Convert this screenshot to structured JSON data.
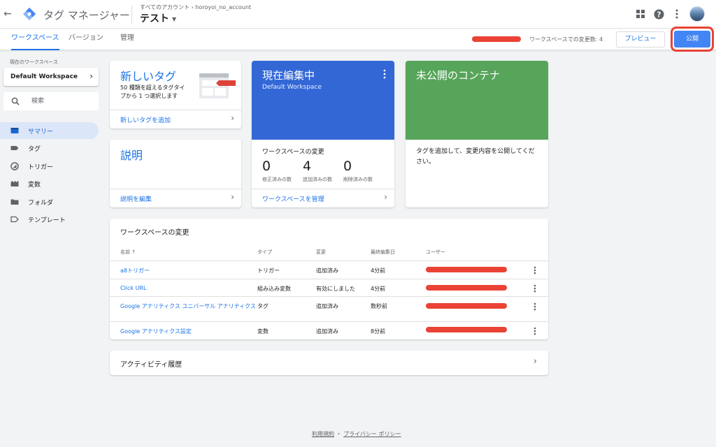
{
  "header": {
    "app_title": "タグ マネージャー",
    "account_breadcrumb": "すべてのアカウント › horoyoi_no_account",
    "container_name": "テスト",
    "icons": [
      "apps-grid-icon",
      "help-icon",
      "more-vert-icon",
      "account-avatar"
    ]
  },
  "tabs": [
    {
      "label": "ワークスペース",
      "active": true
    },
    {
      "label": "バージョン",
      "active": false
    },
    {
      "label": "管理",
      "active": false
    }
  ],
  "toolbar": {
    "workspace_changes": "ワークスペースでの変更数: 4",
    "preview_label": "プレビュー",
    "publish_label": "公開"
  },
  "sidebar": {
    "current_workspace_label": "現在のワークスペース",
    "workspace_name": "Default Workspace",
    "search_placeholder": "検索",
    "items": [
      {
        "label": "サマリー",
        "icon": "summary-icon",
        "active": true
      },
      {
        "label": "タグ",
        "icon": "tag-icon",
        "active": false
      },
      {
        "label": "トリガー",
        "icon": "trigger-icon",
        "active": false
      },
      {
        "label": "変数",
        "icon": "variable-icon",
        "active": false
      },
      {
        "label": "フォルダ",
        "icon": "folder-icon",
        "active": false
      },
      {
        "label": "テンプレート",
        "icon": "template-icon",
        "active": false
      }
    ]
  },
  "cards": {
    "new_tag": {
      "title": "新しいタグ",
      "description": "50 種類を超えるタグタイプから 1 つ選択します",
      "link": "新しいタグを追加"
    },
    "description": {
      "title": "説明",
      "link": "説明を編集"
    },
    "editing": {
      "title": "現在編集中",
      "workspace": "Default Workspace",
      "changes_label": "ワークスペースの変更",
      "stats": [
        {
          "value": "0",
          "label": "修正済みの数"
        },
        {
          "value": "4",
          "label": "追加済みの数"
        },
        {
          "value": "0",
          "label": "削除済みの数"
        }
      ],
      "link": "ワークスペースを管理"
    },
    "unpublished": {
      "title": "未公開のコンテナ",
      "body": "タグを追加して、変更内容を公開してください。"
    }
  },
  "changes_table": {
    "title": "ワークスペースの変更",
    "headers": [
      "名前 ↑",
      "タイプ",
      "変更",
      "最終編集日",
      "ユーザー"
    ],
    "rows": [
      {
        "name": "a8トリガー",
        "type": "トリガー",
        "change": "追加済み",
        "edited": "4分前"
      },
      {
        "name": "Click URL",
        "type": "組み込み変数",
        "change": "有効にしました",
        "edited": "4分前"
      },
      {
        "name": "Google アナリティクス ユニバーサル アナリティクス",
        "type": "タグ",
        "change": "追加済み",
        "edited": "数秒前"
      },
      {
        "name": "Google アナリティクス設定",
        "type": "変数",
        "change": "追加済み",
        "edited": "8分前"
      }
    ]
  },
  "activity": {
    "title": "アクティビティ履歴"
  },
  "footer": {
    "terms": "利用規約",
    "separator": "・",
    "privacy": "プライバシー ポリシー"
  },
  "colors": {
    "accent_blue": "#1a73e8",
    "editing_blue": "#3367d6",
    "unpublished_green": "#57a55a",
    "publish_button": "#4285f4",
    "redaction_red": "#ea4335"
  }
}
